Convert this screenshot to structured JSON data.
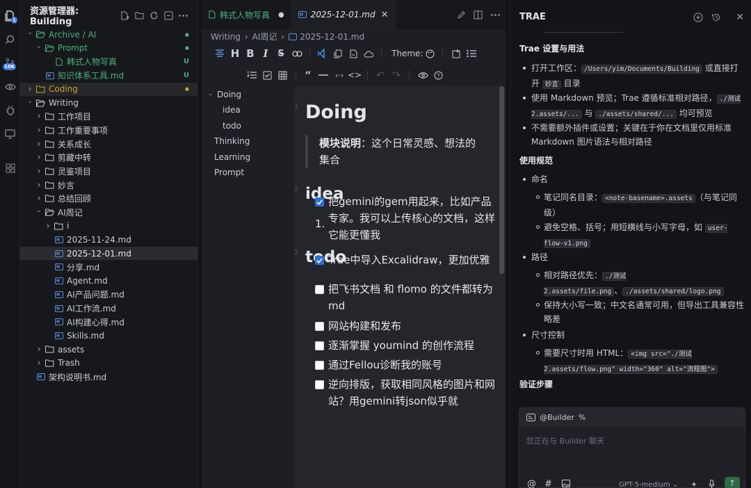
{
  "activity": {
    "badge_files": "1",
    "badge_count": "10K"
  },
  "explorer": {
    "title": "资源管理器: Building",
    "rows": [
      {
        "label": "Archive / AI",
        "status": "●"
      },
      {
        "label": "Prompt",
        "status": "●"
      },
      {
        "label": "韩式人物写真",
        "status": "U"
      },
      {
        "label": "知识体系工具.md",
        "status": "U"
      },
      {
        "label": "Coding",
        "status": "●"
      },
      {
        "label": "Writing"
      },
      {
        "label": "工作项目"
      },
      {
        "label": "工作重要事项"
      },
      {
        "label": "关系成长"
      },
      {
        "label": "剪藏中转"
      },
      {
        "label": "灵鉴项目"
      },
      {
        "label": "妙言"
      },
      {
        "label": "总结回顾"
      },
      {
        "label": "AI周记"
      },
      {
        "label": "i"
      },
      {
        "label": "2025-11-24.md"
      },
      {
        "label": "2025-12-01.md"
      },
      {
        "label": "分享.md"
      },
      {
        "label": "Agent.md"
      },
      {
        "label": "AI产品问题.md"
      },
      {
        "label": "AI工作流.md"
      },
      {
        "label": "AI构建心得.md"
      },
      {
        "label": "Skills.md"
      },
      {
        "label": "assets"
      },
      {
        "label": "Trash"
      },
      {
        "label": "架构说明书.md"
      }
    ],
    "colors": {
      "green": "#49b07d",
      "orange": "#c9a227",
      "blue_file": "#5b8fe0"
    }
  },
  "editor": {
    "tabs": [
      {
        "label": "韩式人物写真"
      },
      {
        "label": "2025-12-01.md"
      }
    ],
    "breadcrumb": {
      "a": "Writing",
      "b": "AI周记",
      "c": "2025-12-01.md"
    },
    "toolbar": {
      "theme_label": "Theme:"
    },
    "outline": [
      "Doing",
      "idea",
      "todo",
      "Thinking",
      "Learning",
      "Prompt"
    ],
    "doc": {
      "h_doing": "Doing",
      "quote_bold": "模块说明",
      "quote_text": "：这个日常灵感、想法的集合",
      "h_idea": "idea",
      "list_item": "1.",
      "h_todo": "todo",
      "line_nums": [
        "1",
        "2",
        "2"
      ],
      "todos": [
        {
          "text": "把gemini的gem用起来，比如产品专家。我可以上传核心的文档，这样它能更懂我",
          "checked": true
        },
        {
          "text": "Trae中导入Excalidraw，更加优雅",
          "checked": true
        },
        {
          "text": "把飞书文档 和 flomo 的文件都转为 md",
          "checked": false
        },
        {
          "text": "网站构建和发布",
          "checked": false
        },
        {
          "text": "逐渐掌握 youmind 的创作流程",
          "checked": false
        },
        {
          "text": "通过Fellou诊断我的账号",
          "checked": false
        },
        {
          "text": "逆向排版，获取相同风格的图片和网站？用gemini转json似乎就",
          "checked": false
        }
      ]
    }
  },
  "trae": {
    "title": "TRAE",
    "sec1_title": "Trae 设置与用法",
    "s1_b1_pre": "打开工作区：",
    "s1_b1_code": "/Users/yim/Documents/Building",
    "s1_b1_mid": " 或直接打开 ",
    "s1_b1_code2": "妙言",
    "s1_b1_post": " 目录",
    "s1_b2_pre": "使用 Markdown 预览；Trae 遵循标准相对路径，",
    "s1_b2_code1": "./测试 2.assets/...",
    "s1_b2_mid": " 与 ",
    "s1_b2_code2": "./assets/shared/...",
    "s1_b2_post": " 均可预览",
    "s1_b3": "不需要额外插件或设置；关键在于你在文档里仅用标准 Markdown 图片语法与相对路径",
    "sec2_title": "使用规范",
    "naming": "命名",
    "n1_pre": "笔记同名目录：",
    "n1_code": "<note-basename>.assets",
    "n1_post": "（与笔记同级）",
    "n2_pre": "避免空格、括号；用短横线与小写字母，如 ",
    "n2_code": "user-flow-v1.png",
    "path": "路径",
    "p1_pre": "相对路径优先：",
    "p1_code1": "./测试 2.assets/file.png",
    "p1_mid": "、",
    "p1_code2": "./assets/shared/logo.png",
    "p2": "保持大小写一致；中文名通常可用，但导出工具兼容性略差",
    "size": "尺寸控制",
    "s_pre": "需要尺寸时用 HTML：",
    "s_code": "<img src=\"./测试 2.assets/flow.png\" width=\"360\" alt=\"流程图\">",
    "sec3_title": "验证步骤",
    "chat": {
      "agent": "@Builder",
      "placeholder": "您正在与 Builder 聊天",
      "model": "GPT-5-medium"
    }
  }
}
